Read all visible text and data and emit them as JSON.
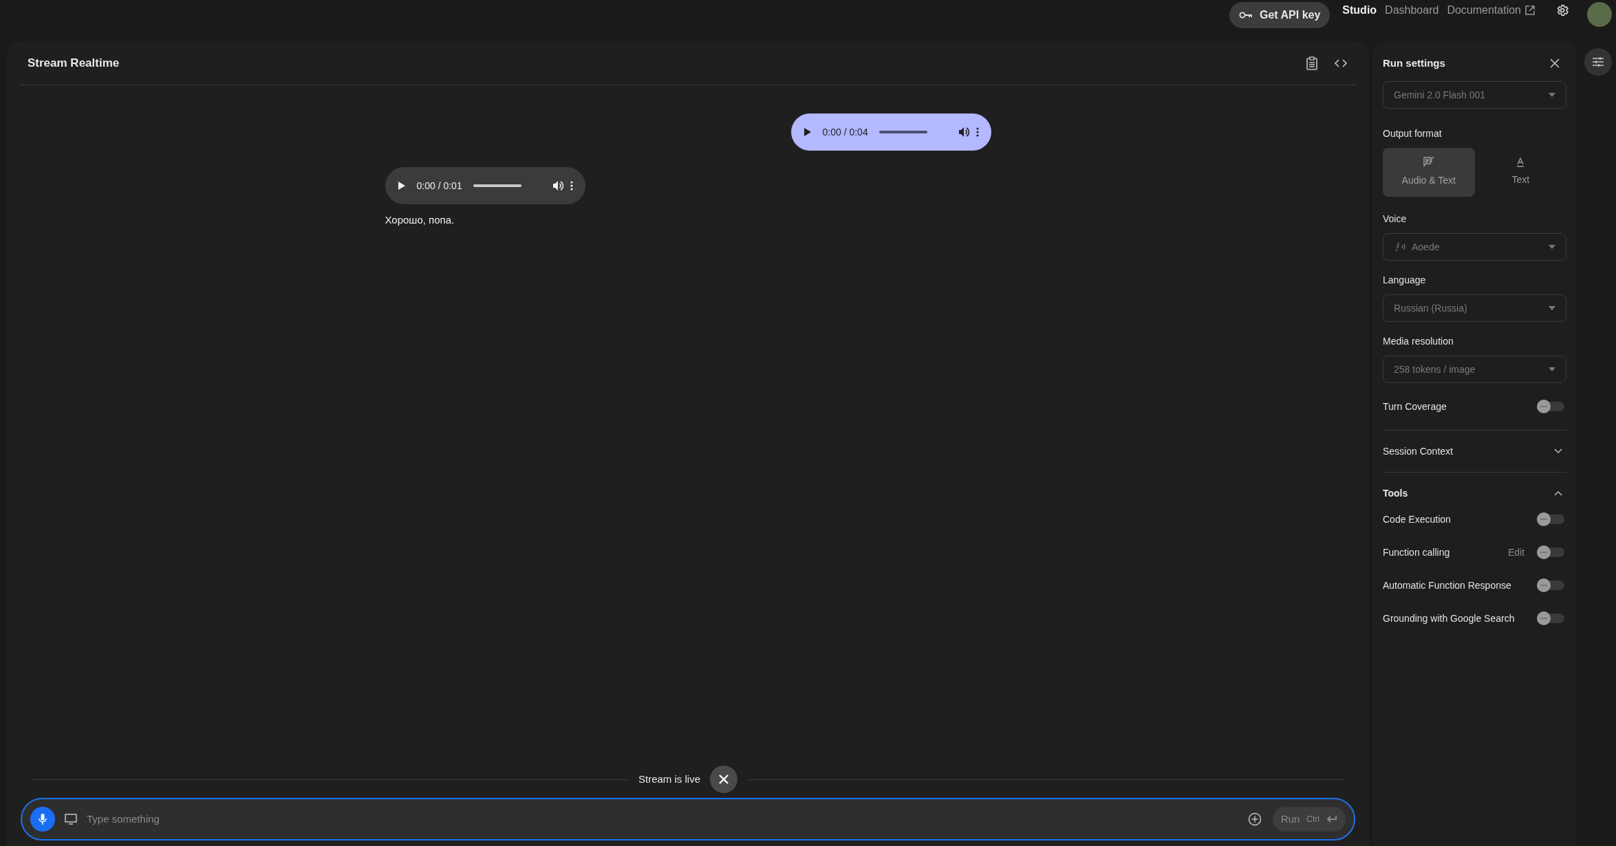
{
  "header": {
    "api_key_button": "Get API key",
    "nav": [
      {
        "label": "Studio",
        "selected": true,
        "kind": "internal"
      },
      {
        "label": "Dashboard",
        "selected": false,
        "kind": "internal"
      },
      {
        "label": "Documentation",
        "selected": false,
        "kind": "external"
      }
    ]
  },
  "main": {
    "title": "Stream Realtime",
    "messages": [
      {
        "kind": "sent",
        "player": {
          "time": "0:00 / 0:04"
        }
      },
      {
        "kind": "reply",
        "player": {
          "time": "0:00 / 0:01"
        },
        "text": "Хорошо, попа."
      }
    ],
    "stream_status": "Stream is live",
    "input": {
      "placeholder": "Type something",
      "run_button": {
        "label": "Run",
        "shortcut": "Ctrl",
        "disabled": true
      }
    }
  },
  "run_settings": {
    "title": "Run settings",
    "model": {
      "value": "Gemini 2.0 Flash 001",
      "disabled": true
    },
    "output_format": {
      "label": "Output format",
      "options": [
        {
          "kind": "audio",
          "label": "Audio & Text",
          "selected": true
        },
        {
          "kind": "text",
          "label": "Text",
          "selected": false
        }
      ]
    },
    "selects": [
      {
        "label": "Voice",
        "value": "Aoede",
        "kind": "voice",
        "disabled": true
      },
      {
        "label": "Language",
        "value": "Russian (Russia)",
        "kind": "plain",
        "disabled": true
      },
      {
        "label": "Media resolution",
        "value": "258 tokens / image",
        "kind": "plain",
        "disabled": true
      }
    ],
    "turn_coverage": {
      "label": "Turn Coverage",
      "on": false
    },
    "session_context": {
      "label": "Session Context",
      "expanded": false
    },
    "tools": {
      "label": "Tools",
      "expanded": true,
      "items": [
        {
          "label": "Code Execution",
          "on": false
        },
        {
          "label": "Function calling",
          "on": false,
          "edit": "Edit"
        },
        {
          "label": "Automatic Function Response",
          "on": false
        },
        {
          "label": "Grounding with Google Search",
          "on": false
        }
      ]
    }
  }
}
